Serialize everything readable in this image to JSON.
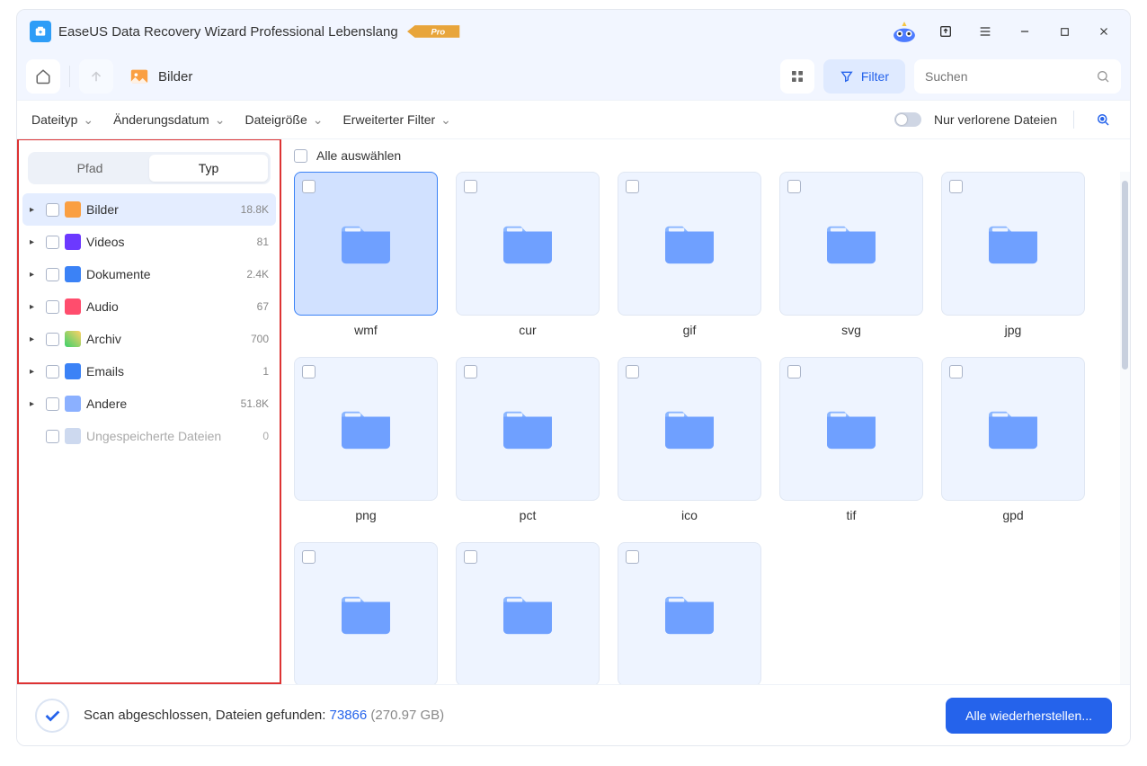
{
  "title": "EaseUS Data Recovery Wizard Professional Lebenslang",
  "pro_label": "Pro",
  "toolbar": {
    "breadcrumb_label": "Bilder",
    "filter_label": "Filter",
    "search_placeholder": "Suchen"
  },
  "filterbar": {
    "dateityp": "Dateityp",
    "aenderungsdatum": "Änderungsdatum",
    "dateigroesse": "Dateigröße",
    "erweiterter_filter": "Erweiterter Filter",
    "nur_verlorene": "Nur verlorene Dateien"
  },
  "sidebar": {
    "tab_pfad": "Pfad",
    "tab_typ": "Typ",
    "items": [
      {
        "label": "Bilder",
        "count": "18.8K",
        "icon": "ci-img",
        "selected": true
      },
      {
        "label": "Videos",
        "count": "81",
        "icon": "ci-vid"
      },
      {
        "label": "Dokumente",
        "count": "2.4K",
        "icon": "ci-doc"
      },
      {
        "label": "Audio",
        "count": "67",
        "icon": "ci-aud"
      },
      {
        "label": "Archiv",
        "count": "700",
        "icon": "ci-arc"
      },
      {
        "label": "Emails",
        "count": "1",
        "icon": "ci-mail"
      },
      {
        "label": "Andere",
        "count": "51.8K",
        "icon": "ci-other"
      },
      {
        "label": "Ungespeicherte Dateien",
        "count": "0",
        "icon": "ci-unsaved",
        "faded": true,
        "no_caret": true
      }
    ]
  },
  "content": {
    "select_all": "Alle auswählen",
    "folders": [
      {
        "name": "wmf",
        "selected": true
      },
      {
        "name": "cur"
      },
      {
        "name": "gif"
      },
      {
        "name": "svg"
      },
      {
        "name": "jpg"
      },
      {
        "name": "png"
      },
      {
        "name": "pct"
      },
      {
        "name": "ico"
      },
      {
        "name": "tif"
      },
      {
        "name": "gpd"
      },
      {
        "name": ""
      },
      {
        "name": ""
      },
      {
        "name": ""
      }
    ]
  },
  "status": {
    "prefix": "Scan abgeschlossen, Dateien gefunden: ",
    "count": "73866",
    "size": " (270.97 GB)",
    "recover_label": "Alle wiederherstellen..."
  }
}
